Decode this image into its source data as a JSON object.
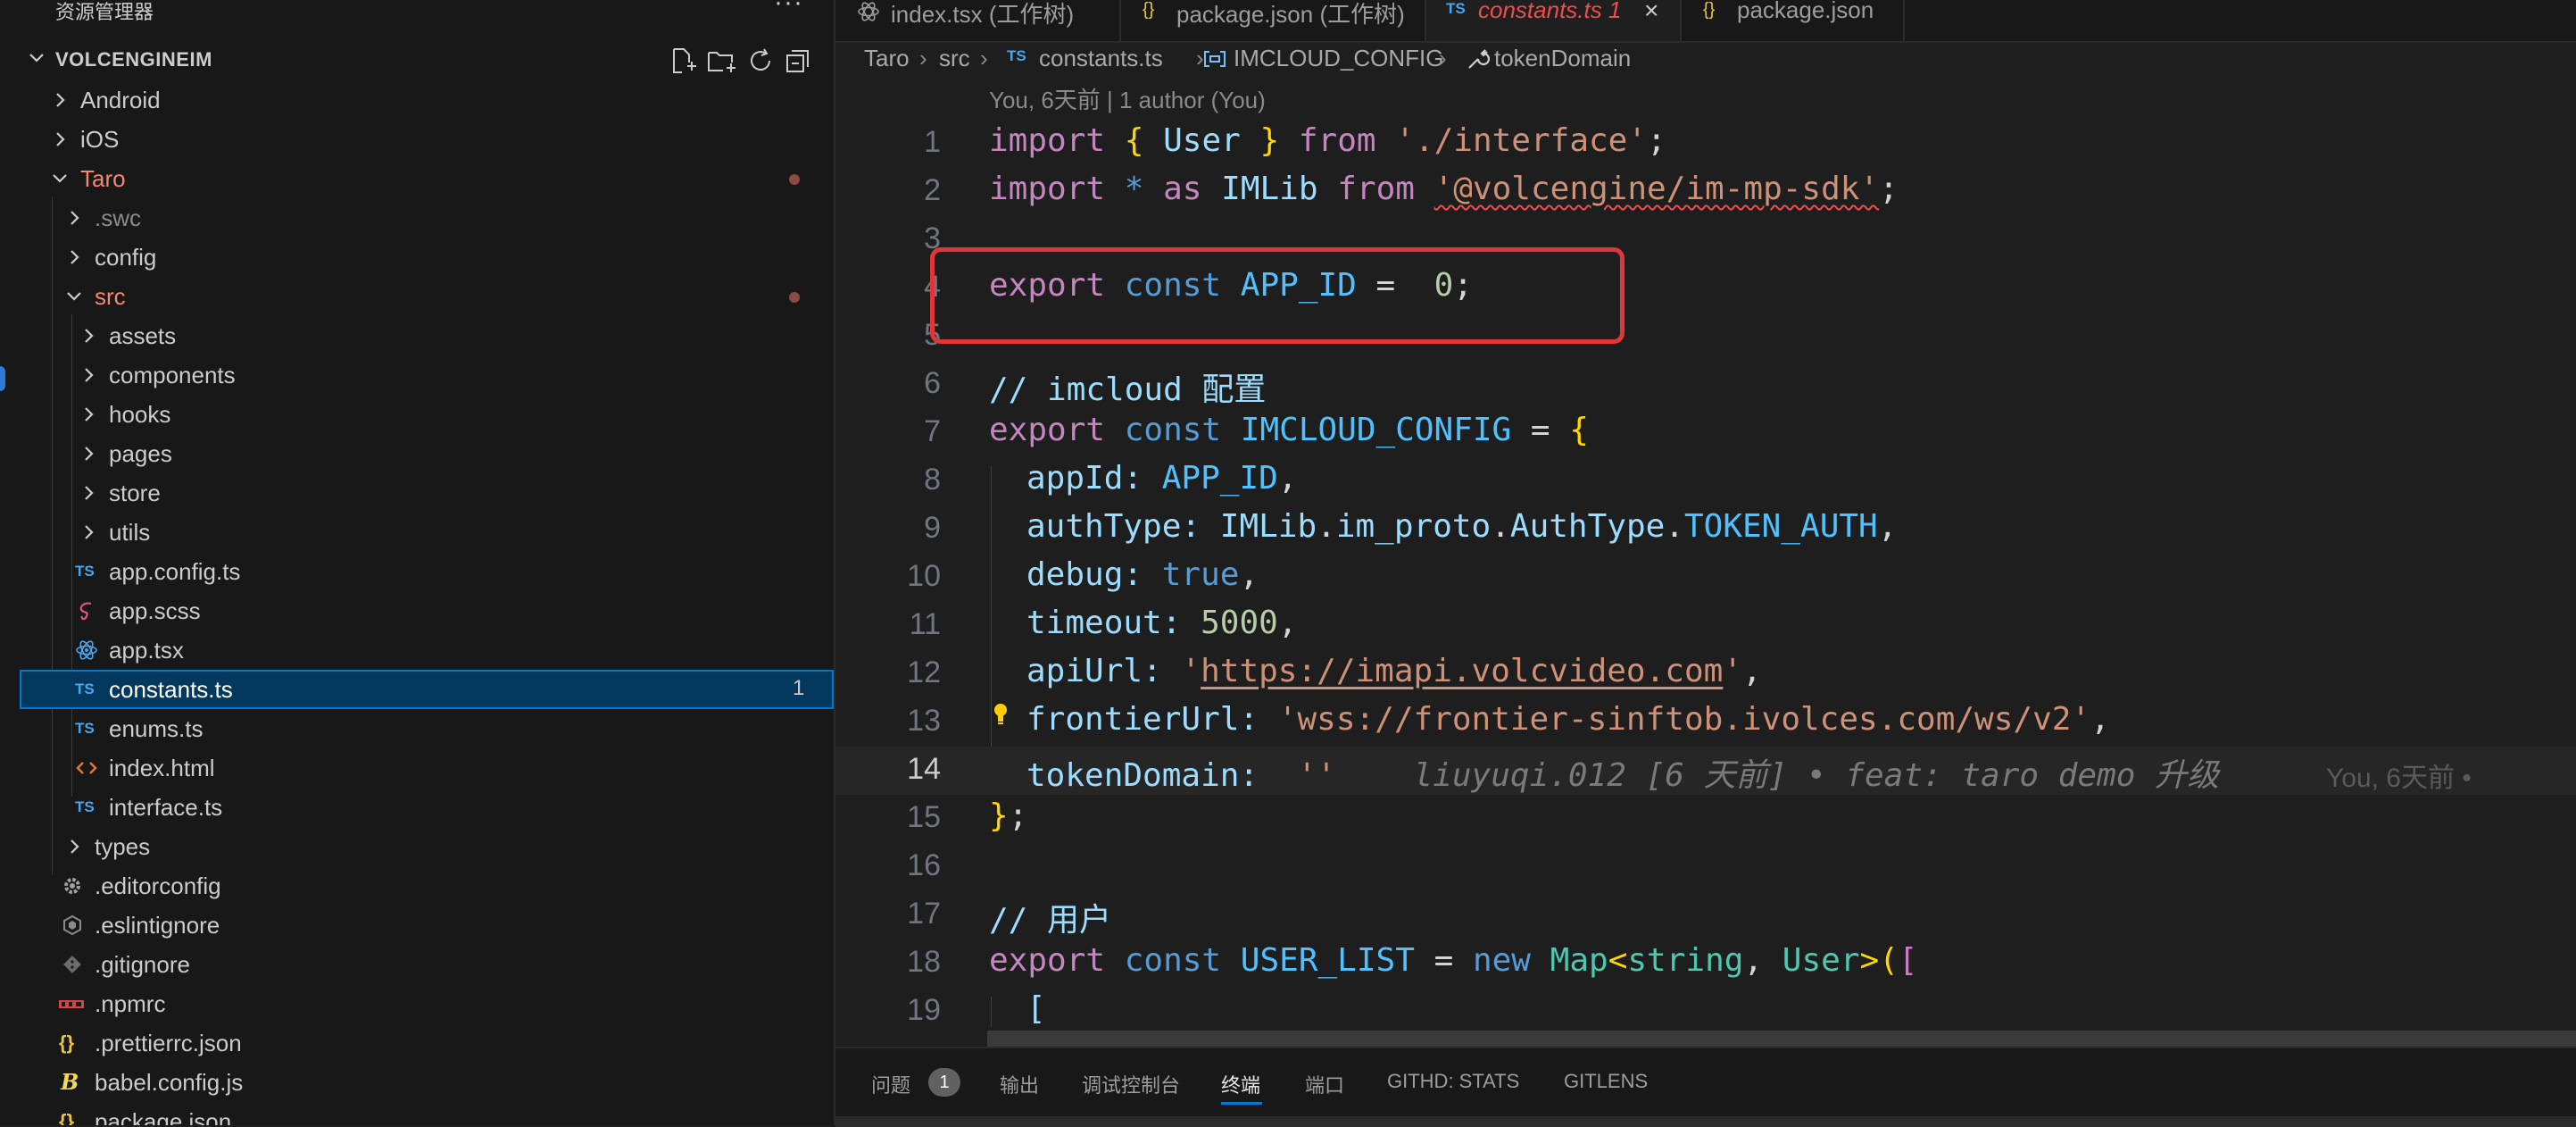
{
  "sidebar": {
    "title": "资源管理器",
    "more_label": "···",
    "project": "VOLCENGINEIM",
    "items": [
      {
        "label": "Android",
        "type": "folder"
      },
      {
        "label": "iOS",
        "type": "folder"
      },
      {
        "label": "Taro",
        "type": "folder"
      },
      {
        "label": ".swc",
        "type": "folder"
      },
      {
        "label": "config",
        "type": "folder"
      },
      {
        "label": "src",
        "type": "folder"
      },
      {
        "label": "assets",
        "type": "folder"
      },
      {
        "label": "components",
        "type": "folder"
      },
      {
        "label": "hooks",
        "type": "folder"
      },
      {
        "label": "pages",
        "type": "folder"
      },
      {
        "label": "store",
        "type": "folder"
      },
      {
        "label": "utils",
        "type": "folder"
      },
      {
        "label": "app.config.ts",
        "type": "ts"
      },
      {
        "label": "app.scss",
        "type": "scss"
      },
      {
        "label": "app.tsx",
        "type": "tsx"
      },
      {
        "label": "constants.ts",
        "type": "ts",
        "count": "1"
      },
      {
        "label": "enums.ts",
        "type": "ts"
      },
      {
        "label": "index.html",
        "type": "html"
      },
      {
        "label": "interface.ts",
        "type": "ts"
      },
      {
        "label": "types",
        "type": "folder"
      },
      {
        "label": ".editorconfig",
        "type": "config"
      },
      {
        "label": ".eslintignore",
        "type": "eslint"
      },
      {
        "label": ".gitignore",
        "type": "git"
      },
      {
        "label": ".npmrc",
        "type": "npm"
      },
      {
        "label": ".prettierrc.json",
        "type": "json"
      },
      {
        "label": "babel.config.js",
        "type": "babel"
      },
      {
        "label": "package.json",
        "type": "json"
      }
    ],
    "ts_icon_text": "TS"
  },
  "tabs": [
    {
      "label": "index.tsx (工作树)",
      "icon": "react-icon"
    },
    {
      "label": "package.json (工作树)",
      "icon": "{}"
    },
    {
      "label": "constants.ts 1",
      "icon": "TS"
    },
    {
      "label": "package.json",
      "icon": "{}"
    }
  ],
  "breadcrumb": [
    "Taro",
    "src",
    "constants.ts",
    "IMCLOUD_CONFIG",
    "tokenDomain"
  ],
  "breadcrumb_icon_ts": "TS",
  "codelens": "You, 6天前 | 1 author (You)",
  "line_numbers": [
    "1",
    "2",
    "3",
    "4",
    "5",
    "6",
    "7",
    "8",
    "9",
    "10",
    "11",
    "12",
    "13",
    "14",
    "15",
    "16",
    "17",
    "18",
    "19"
  ],
  "code": {
    "l1": [
      "import",
      "{",
      "User",
      "}",
      "from",
      "'./interface'",
      ";"
    ],
    "l2": [
      "import",
      "*",
      "as",
      "IMLib",
      "from",
      "'@volcengine/im-mp-sdk'",
      ";"
    ],
    "l4": [
      "export",
      "const",
      "APP_ID",
      "=",
      "0",
      ";"
    ],
    "l6": "// imcloud 配置",
    "l7": [
      "export",
      "const",
      "IMCLOUD_CONFIG",
      "=",
      "{"
    ],
    "l8": [
      "appId",
      ":",
      "APP_ID",
      ","
    ],
    "l9": [
      "authType",
      ":",
      "IMLib",
      ".",
      "im_proto",
      ".",
      "AuthType",
      ".",
      "TOKEN_AUTH",
      ","
    ],
    "l10": [
      "debug",
      ":",
      "true",
      ","
    ],
    "l11": [
      "timeout",
      ":",
      "5000",
      ","
    ],
    "l12": [
      "apiUrl",
      ":",
      "'",
      "https://imapi.volcvideo.com",
      "'",
      ","
    ],
    "l13": [
      "frontierUrl",
      ":",
      "'wss://frontier-sinftob.ivolces.com/ws/v2'",
      ","
    ],
    "l14": [
      "tokenDomain",
      ":",
      "''"
    ],
    "l14_blame": "liuyuqi.012 [6 天前] • feat: taro demo 升级",
    "l14_blame2": "You, 6天前 •",
    "l15": [
      "}",
      ";"
    ],
    "l17": "// 用户",
    "l18": [
      "export",
      "const",
      "USER_LIST",
      "=",
      "new",
      "Map",
      "<",
      "string",
      ",",
      "User",
      ">",
      "(",
      "["
    ],
    "l19": "["
  },
  "panel": {
    "tabs": [
      "问题",
      "输出",
      "调试控制台",
      "终端",
      "端口",
      "GITHD: STATS",
      "GITLENS"
    ],
    "problems_count": "1",
    "active": "终端"
  },
  "colors": {
    "highlight_box": "#e0363a",
    "selection": "#04395e",
    "accent": "#0078d4"
  }
}
